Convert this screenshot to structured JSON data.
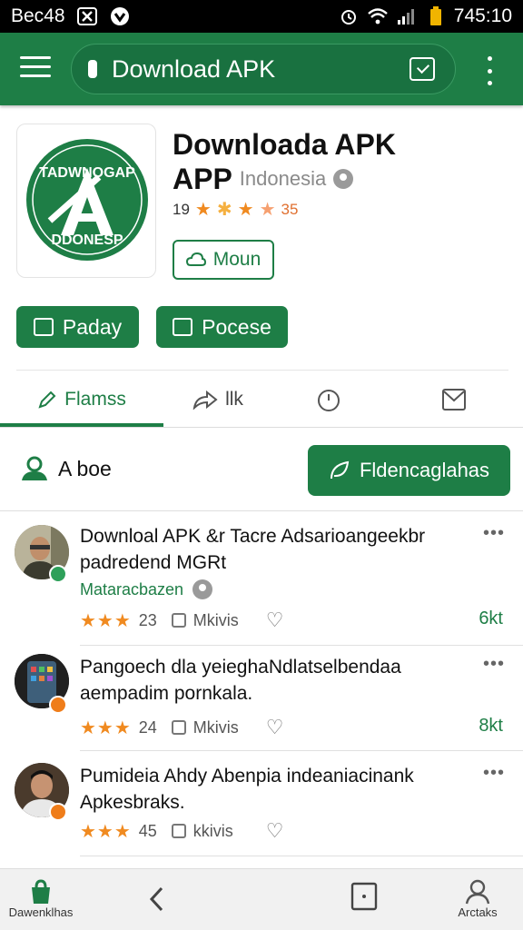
{
  "status_bar": {
    "carrier": "Bec48",
    "time": "745:10"
  },
  "app_bar": {
    "search_text": "Download APK"
  },
  "app": {
    "logo_text_top": "TADWNOGAP",
    "logo_text_bottom": "DDONESP",
    "title_line1": "Downloada APK",
    "title_line2": "APP",
    "region": "Indonesia",
    "rating_left": "19",
    "rating_right": "35",
    "mount_label": "Moun",
    "btn_primary_1": "Paday",
    "btn_primary_2": "Pocese"
  },
  "tabs": [
    {
      "label": "Flamss",
      "icon": "pen-icon",
      "active": true
    },
    {
      "label": "llk",
      "icon": "share-icon",
      "active": false
    },
    {
      "label": "",
      "icon": "timer-icon",
      "active": false
    },
    {
      "label": "",
      "icon": "mail-icon",
      "active": false
    }
  ],
  "about": {
    "label": "A boe",
    "cta": "Fldencaglahas"
  },
  "feed": [
    {
      "text": "Downloal APK &r Tacre Adsarioangeekbr padredend MGRt",
      "source": "Mataracbazen",
      "stars": "★★★",
      "count": "23",
      "share_label": "Mkivis",
      "size": "6kt",
      "more": "•••"
    },
    {
      "text": "Pangoech dla yeieghaNdlatselbendaa aempadim pornkala.",
      "source": "",
      "stars": "★★★",
      "count": "24",
      "share_label": "Mkivis",
      "size": "8kt",
      "more": "•••"
    },
    {
      "text": "Pumideia Ahdy Abenpia indeaniacinank Apkesbraks.",
      "source": "",
      "stars": "★★★",
      "count": "45",
      "share_label": "kkivis",
      "size": "",
      "more": "•••"
    }
  ],
  "bottom_nav": {
    "left_label": "Dawenklhas",
    "right_label": "Arctaks"
  },
  "colors": {
    "brand_green": "#1e7e46",
    "star_orange": "#f08a20"
  }
}
